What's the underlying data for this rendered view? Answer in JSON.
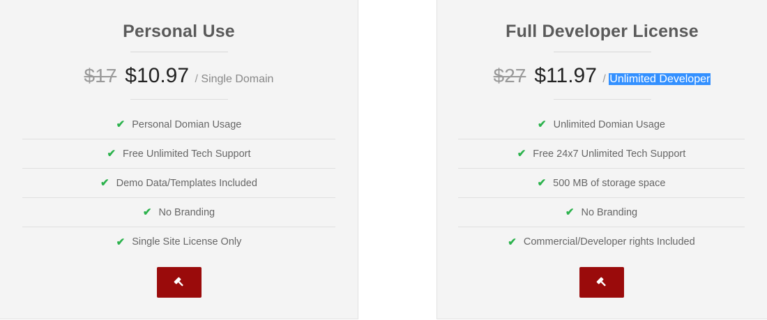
{
  "plans": [
    {
      "title": "Personal Use",
      "old_price": "$17",
      "price": "$10.97",
      "slash": "/",
      "price_note": "Single Domain",
      "features": [
        "Personal Domian Usage",
        "Free Unlimited Tech Support",
        "Demo Data/Templates Included",
        "No Branding",
        "Single Site License Only"
      ],
      "button_icon": "gavel-icon"
    },
    {
      "title": "Full Developer License",
      "old_price": "$27",
      "price": "$11.97",
      "slash": "/",
      "price_note": "Unlimited Developer",
      "features": [
        "Unlimited Domian Usage",
        "Free 24x7 Unlimited Tech Support",
        "500 MB of storage space",
        "No Branding",
        "Commercial/Developer rights Included"
      ],
      "button_icon": "gavel-icon"
    }
  ],
  "colors": {
    "check": "#2bb24c",
    "button": "#9a0b0b",
    "selection_highlight": "#3390ff",
    "card_background": "#f4f4f4"
  }
}
